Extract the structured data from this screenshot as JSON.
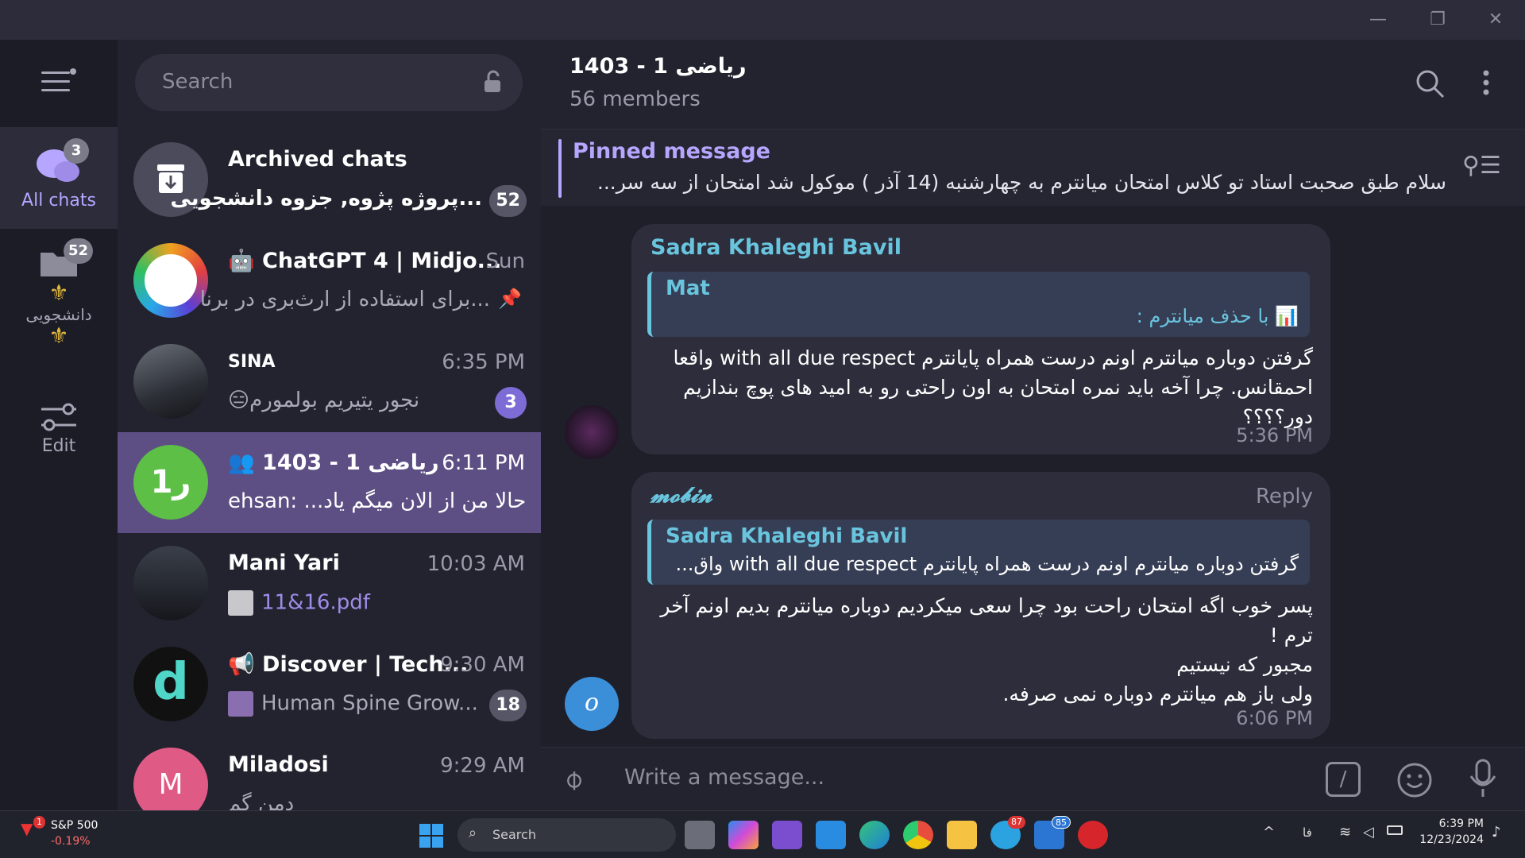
{
  "window": {
    "minimize_label": "—",
    "restore_label": "❐",
    "close_label": "✕"
  },
  "rail": {
    "all_chats_label": "All chats",
    "all_chats_badge": "3",
    "folder_badge": "52",
    "folder_label": "دانشجویی",
    "edit_label": "Edit"
  },
  "search": {
    "placeholder": "Search"
  },
  "chats": [
    {
      "title": "Archived chats",
      "subtitle": "...پروژه پژوه, جزوه دانشجویی",
      "time": "",
      "count": "52"
    },
    {
      "title": "ChatGPT 4 | Midjo...",
      "subtitle": "...برای استفاده از ارث‌بری در برنا",
      "time": "Sun",
      "count": ""
    },
    {
      "title": "SINA",
      "subtitle": "😑نجور یتیریم بولمورم",
      "time": "6:35 PM",
      "count": "3"
    },
    {
      "title": "1403 - 1 ریاضی",
      "subtitle": "ehsan: ...حالا من از الان میگم یاد",
      "time": "6:11 PM",
      "count": "",
      "avatar_text": "ر1"
    },
    {
      "title": "Mani Yari",
      "subtitle": "11&16.pdf",
      "time": "10:03 AM",
      "count": ""
    },
    {
      "title": "Discover | Tech...",
      "subtitle": "Human Spine Grow...",
      "time": "9:30 AM",
      "count": "18",
      "avatar_text": "d"
    },
    {
      "title": "Miladosi",
      "subtitle": "دمن گم",
      "time": "9:29 AM",
      "count": "",
      "avatar_text": "M"
    }
  ],
  "chat": {
    "title": "1403 - 1 ریاضی",
    "members": "56 members",
    "pinned_label": "Pinned message",
    "pinned_text": "سلام  طبق صحبت استاد تو کلاس امتحان میانترم به چهارشنبه  (14 آذر ) موکول شد  امتحان از سه سر...",
    "messages": [
      {
        "sender": "Sadra Khaleghi Bavil",
        "quote_sender": "Mat",
        "quote_text": "📊 با حذف میانترم :",
        "text_lines": [
          "گرفتن دوباره میانترم اونم درست همراه پایانترم with all due respect واقعا",
          "احمقانس. چرا آخه باید نمره امتحان به اون راحتی رو به امید های پوچ بندازیم",
          "دور؟؟؟؟"
        ],
        "time": "5:36 PM"
      },
      {
        "sender": "𝓶𝓸𝓫𝓲𝓷",
        "reply_label": "Reply",
        "quote_sender": "Sadra Khaleghi Bavil",
        "quote_text": "گرفتن دوباره میانترم اونم درست همراه پایانترم with all due respect واق...",
        "text_lines": [
          "پسر خوب اگه امتحان راحت بود چرا سعی میکردیم دوباره میانترم بدیم اونم آخر",
          "ترم !",
          "مجبور که نیستیم",
          "ولی باز هم میانترم دوباره نمی صرفه."
        ],
        "time": "6:06 PM",
        "avatar_text": "o"
      }
    ],
    "composer_placeholder": "Write a message..."
  },
  "taskbar": {
    "stock_name": "S&P 500",
    "stock_change": "-0.19%",
    "stock_badge": "1",
    "search_label": "Search",
    "telegram_badge": "87",
    "app_badge": "85",
    "lang": "فا",
    "time": "6:39 PM",
    "date": "12/23/2024"
  },
  "colors": {
    "accent": "#b7a6ff",
    "active_row": "#5d4f84",
    "bubble": "#2d2d3c",
    "quote_border": "#69c4de",
    "sender_cyan": "#69c4de"
  }
}
